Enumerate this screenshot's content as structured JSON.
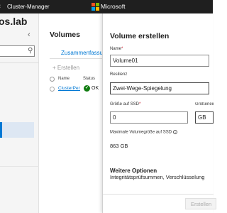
{
  "topbar": {
    "app_name": "Cluster-Manager",
    "brand": "Microsoft"
  },
  "left": {
    "host_title": "os.lab"
  },
  "middle": {
    "title": "Volumes",
    "tab_summary": "Zusammenfassung",
    "create_label": "+ Erstellen",
    "col_name": "Name",
    "col_status": "Status",
    "row_name": "ClusterPerformanceHistory",
    "row_status": "OK"
  },
  "panel": {
    "title": "Volume erstellen",
    "name_label": "Name",
    "name_value": "Volume01",
    "resiliency_label": "Resilienz",
    "resiliency_value": "Zwei-Wege-Spiegelung",
    "ssd_size_label": "Größe auf SSD",
    "ssd_size_value": "0",
    "size_unit_label": "Größeneinheit",
    "size_unit_value": "GB",
    "max_size_label": "Maximale Volumegröße auf SSD",
    "max_size_value": "863 GB",
    "more_options_title": "Weitere Optionen",
    "more_options_desc": "Integritätsprüfsummen, Verschlüsselung",
    "submit_label": "Erstellen"
  },
  "colors": {
    "accent": "#0078d4",
    "topbar": "#1f1f1f",
    "ok": "#107c10",
    "required": "#c50f1f"
  }
}
